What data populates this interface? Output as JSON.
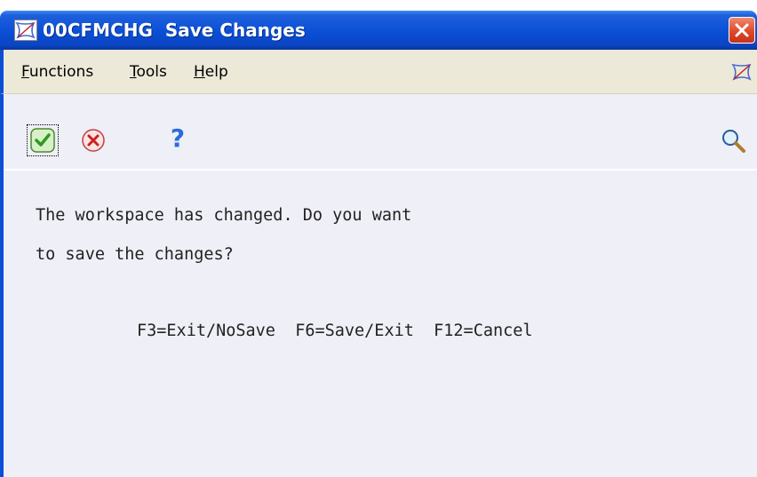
{
  "window": {
    "program_id": "00CFMCHG",
    "title": "Save Changes",
    "close_icon": "close-icon",
    "logo_icon": "jde-logo-icon"
  },
  "menu": {
    "items": [
      {
        "label": "Functions",
        "mnemonic": "F"
      },
      {
        "label": "Tools",
        "mnemonic": "T"
      },
      {
        "label": "Help",
        "mnemonic": "H"
      }
    ]
  },
  "toolbar": {
    "ok_icon": "checkmark-icon",
    "cancel_icon": "cancel-icon",
    "help_label": "?",
    "search_icon": "magnifier-icon"
  },
  "message": {
    "line1": "The workspace has changed. Do you want",
    "line2": "to save the changes?",
    "keys": "F3=Exit/NoSave  F6=Save/Exit  F12=Cancel"
  },
  "colors": {
    "titlebar": "#0a4fd6",
    "menubar": "#ece9d8",
    "content_bg": "#efeff7",
    "close_button": "#e0482a"
  }
}
